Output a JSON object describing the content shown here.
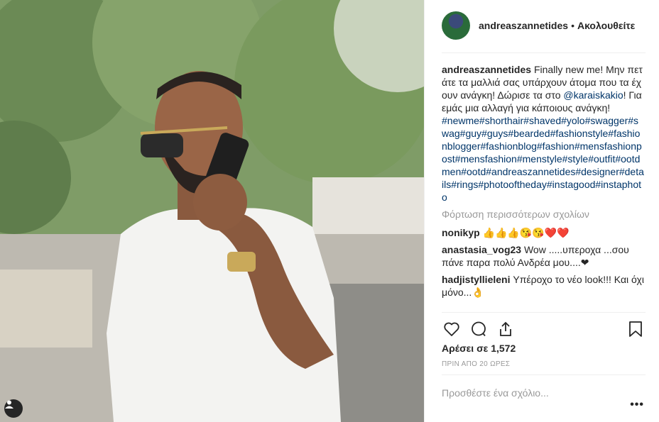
{
  "header": {
    "username": "andreaszannetides",
    "separator": "•",
    "follow_label": "Ακολουθείτε"
  },
  "caption": {
    "username": "andreaszannetides",
    "text_part1": " Finally new me! Μην πετάτε τα μαλλιά σας υπάρχουν άτομα που τα έχουν ανάγκη! Δώρισε τα στο ",
    "mention": "@karaiskakio",
    "text_part2": "! Για εμάς μια αλλαγή για κάποιους ανάγκη!",
    "hashtags": "#newme#shorthair#shaved#yolo#swagger#swag#guy#guys#bearded#fashionstyle#fashionblogger#fashionblog#fashion#mensfashionpost#mensfashion#menstyle#style#outfit#ootdmen#ootd#andreaszannetides#designer#details#rings#photooftheday#instagood#instaphoto"
  },
  "load_more": "Φόρτωση περισσότερων σχολίων",
  "comments": [
    {
      "user": "nonikyp",
      "text": " 👍👍👍😘😘❤️❤️"
    },
    {
      "user": "anastasia_vog23",
      "text": " Wow .....υπεροχα ...σου πάνε παρα πολύ Ανδρέα μου....❤"
    },
    {
      "user": "hadjistyllieleni",
      "text": " Υπέροχο το νέο look!!! Και όχι μόνο...👌"
    }
  ],
  "likes": "Αρέσει σε 1,572",
  "time": "ΠΡΙΝ ΑΠΟ 20 ΩΡΕΣ",
  "add_comment_placeholder": "Προσθέστε ένα σχόλιο...",
  "more_label": "•••",
  "icons": [
    "heart-icon",
    "comment-icon",
    "share-icon",
    "bookmark-icon",
    "user-tag-icon"
  ]
}
